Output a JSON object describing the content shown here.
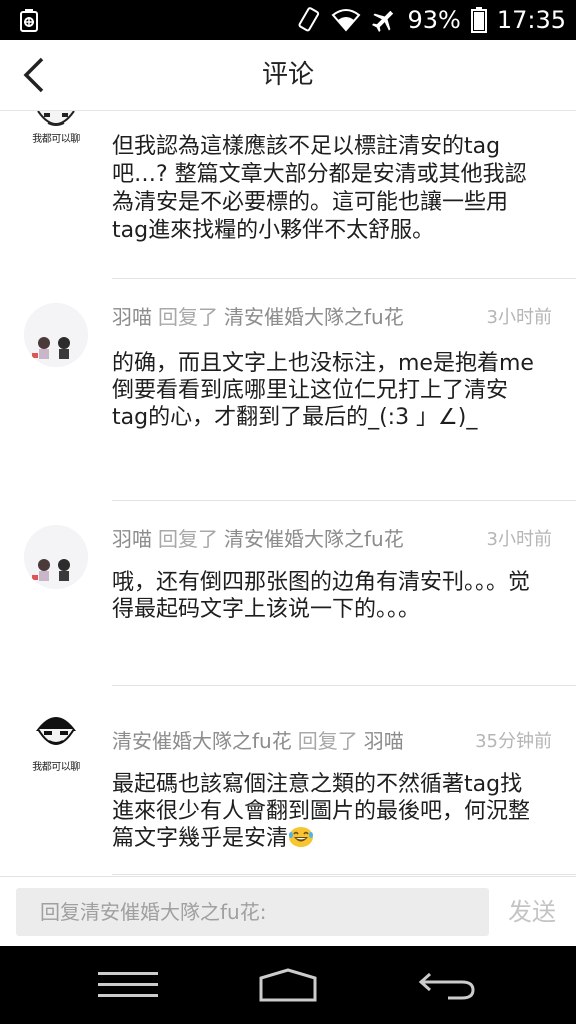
{
  "status_bar": {
    "battery_percent": "93%",
    "time": "17:35"
  },
  "header": {
    "title": "评论"
  },
  "comments": [
    {
      "body": "但我認為這樣應該不足以標註清安的tag吧…? 整篇文章大部分都是安清或其他我認為清安是不必要標的。這可能也讓一些用tag進來找糧的小夥伴不太舒服。"
    },
    {
      "author": "羽喵",
      "action": "回复了",
      "target": "清安催婚大隊之fu花",
      "time": "3小时前",
      "body": "的确，而且文字上也没标注，me是抱着me倒要看看到底哪里让这位仁兄打上了清安tag的心，才翻到了最后的_(:3 」∠)_"
    },
    {
      "author": "羽喵",
      "action": "回复了",
      "target": "清安催婚大隊之fu花",
      "time": "3小时前",
      "body": "哦，还有倒四那张图的边角有清安刊。。。觉得最起码文字上该说一下的。。。"
    },
    {
      "author": "清安催婚大隊之fu花",
      "action": "回复了",
      "target": "羽喵",
      "time": "35分钟前",
      "body": "最起碼也該寫個注意之類的不然循著tag找進來很少有人會翻到圖片的最後吧，何況整篇文字幾乎是安清"
    }
  ],
  "avatar_caption": "我都可以聊",
  "emoji_icon": "laughing-tears-emoji",
  "reply_bar": {
    "placeholder": "回复清安催婚大隊之fu花:",
    "send_label": "发送"
  },
  "colors": {
    "text": "#1e1e1e",
    "meta": "#9a9a9a",
    "send_disabled": "#c4c4c4"
  }
}
